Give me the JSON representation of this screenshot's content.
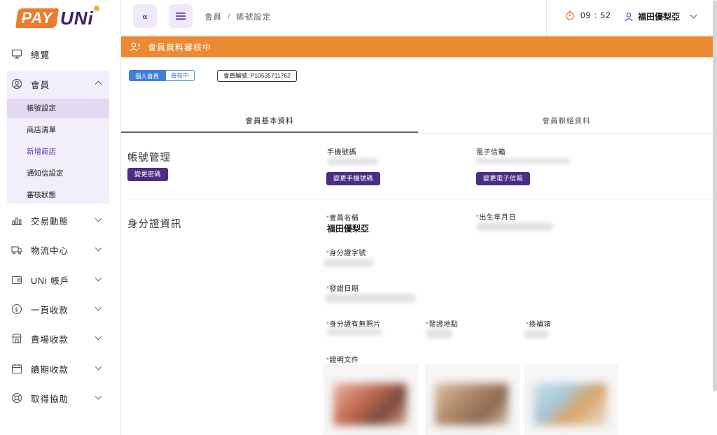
{
  "logo": {
    "pay": "PAY",
    "uni": "UNi"
  },
  "sidebar": {
    "items": [
      {
        "label": "總覽",
        "icon": "monitor-icon"
      },
      {
        "label": "會員",
        "icon": "user-circle-icon"
      },
      {
        "label": "交易動態",
        "icon": "bar-chart-icon"
      },
      {
        "label": "物流中心",
        "icon": "truck-icon"
      },
      {
        "label": "UNi 帳戶",
        "icon": "wallet-icon"
      },
      {
        "label": "一頁收款",
        "icon": "dollar-circle-icon"
      },
      {
        "label": "賣場收款",
        "icon": "store-icon"
      },
      {
        "label": "續期收款",
        "icon": "calendar-icon"
      },
      {
        "label": "取得協助",
        "icon": "lifebuoy-icon"
      }
    ],
    "member_sub": [
      "帳號設定",
      "商店清單",
      "新增商店",
      "通知信設定",
      "審核狀態"
    ]
  },
  "header": {
    "collapse_icon": "«",
    "breadcrumb": [
      "會員",
      "帳號設定"
    ],
    "timer": "09 : 52",
    "user_name": "福田優梨亞"
  },
  "banner": {
    "text": "會員資料審核中"
  },
  "badges": {
    "type": "個人會員",
    "status": "審核中",
    "member_no": "會員編號: P10535711762"
  },
  "tabs": [
    "會員基本資料",
    "會員聯絡資料"
  ],
  "account": {
    "title": "帳號管理",
    "change_password": "變更密碼",
    "phone_label": "手機號碼",
    "change_phone": "變更手機號碼",
    "email_label": "電子信箱",
    "change_email": "變更電子信箱"
  },
  "identity": {
    "title": "身分證資訊",
    "req": "*",
    "name_label": "會員名稱",
    "name_value": "福田優梨亞",
    "birthday_label": "出生年月日",
    "id_label": "身分證字號",
    "issue_date_label": "發證日期",
    "photo_label": "身分證有無照片",
    "issue_place_label": "發證地點",
    "reissue_label": "換補領",
    "docs_label": "證明文件"
  },
  "colors": {
    "accent": "#4b2e83",
    "banner": "#ec8a34",
    "badge": "#3f7fd8",
    "brand_orange": "#ef7a2b"
  }
}
